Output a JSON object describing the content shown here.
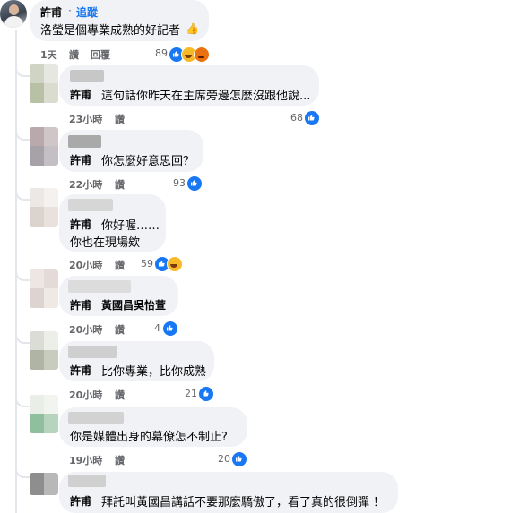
{
  "top_comment": {
    "author": "許甫",
    "follow_label": "追蹤",
    "separator": "·",
    "text": "洛瑩是個專業成熟的好記者",
    "time": "1天",
    "like_label": "讚",
    "reply_label": "回覆",
    "reaction_count": "89"
  },
  "replies": [
    {
      "author": "許甫",
      "text": "這句話你昨天在主席旁邊怎麼沒跟他說...",
      "time": "23小時",
      "like_label": "讚",
      "reaction_count": "68"
    },
    {
      "author": "許甫",
      "text": "你怎麼好意思回？",
      "time": "22小時",
      "like_label": "讚",
      "reaction_count": "93"
    },
    {
      "author": "許甫",
      "text_line1": "你好喔……",
      "text_line2": "你也在現場欸",
      "time": "20小時",
      "like_label": "讚",
      "reaction_count": "59"
    },
    {
      "author": "許甫",
      "text": "黃國昌吳怡萱",
      "time": "20小時",
      "like_label": "讚",
      "reaction_count": "4"
    },
    {
      "author": "許甫",
      "text": "比你專業，比你成熟",
      "time": "20小時",
      "like_label": "讚",
      "reaction_count": "21"
    },
    {
      "text": "你是媒體出身的幕僚怎不制止?",
      "time": "19小時",
      "like_label": "讚",
      "reaction_count": "20"
    },
    {
      "author": "許甫",
      "text": "拜託叫黃國昌講話不要那麼驕傲了，看了真的很倒彈 ！"
    }
  ],
  "icons": {
    "like": "thumbs-up-reaction-icon",
    "haha": "haha-reaction-icon",
    "angry": "angry-reaction-icon",
    "thumbs_emoji": "thumbs-up-emoji-icon"
  },
  "colors": {
    "accent": "#1877f2",
    "bubble": "#f0f2f5",
    "meta_text": "#65676b",
    "thread_line": "#e4e6eb"
  }
}
